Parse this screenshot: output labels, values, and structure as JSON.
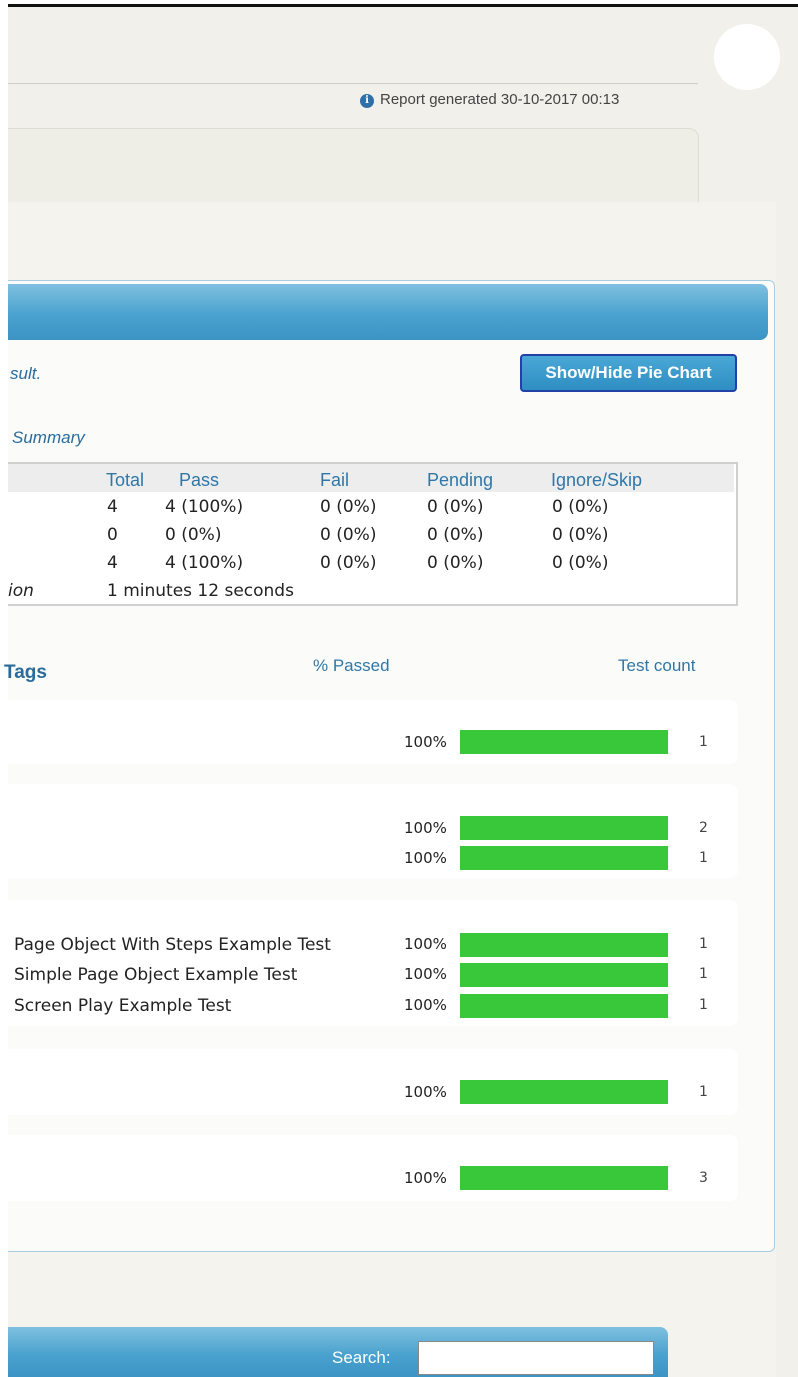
{
  "header": {
    "report_generated": "Report generated 30-10-2017 00:13"
  },
  "panel": {
    "result_text": "sult.",
    "pie_button": "Show/Hide Pie Chart",
    "summary_title": "Summary"
  },
  "summary_table": {
    "columns": [
      "Total",
      "Pass",
      "Fail",
      "Pending",
      "Ignore/Skip"
    ],
    "rows": [
      {
        "label": "",
        "cells": [
          "4",
          "4 (100%)",
          "0 (0%)",
          "0 (0%)",
          "0 (0%)"
        ]
      },
      {
        "label": "",
        "cells": [
          "0",
          "0 (0%)",
          "0 (0%)",
          "0 (0%)",
          "0 (0%)"
        ]
      },
      {
        "label": "",
        "cells": [
          "4",
          "4 (100%)",
          "0 (0%)",
          "0 (0%)",
          "0 (0%)"
        ]
      }
    ],
    "duration_label": "ion",
    "duration_value": "1 minutes 12 seconds"
  },
  "tags": {
    "title": "Tags",
    "passed_header": "% Passed",
    "count_header": "Test count",
    "groups": [
      {
        "rows": [
          {
            "label": "",
            "pct": "100%",
            "fraction": 1.0,
            "count": "1"
          }
        ]
      },
      {
        "rows": [
          {
            "label": "",
            "pct": "100%",
            "fraction": 1.0,
            "count": "2"
          },
          {
            "label": "",
            "pct": "100%",
            "fraction": 1.0,
            "count": "1"
          }
        ]
      },
      {
        "rows": [
          {
            "label": "Page Object With Steps Example Test",
            "pct": "100%",
            "fraction": 1.0,
            "count": "1"
          },
          {
            "label": "Simple Page Object Example Test",
            "pct": "100%",
            "fraction": 1.0,
            "count": "1"
          },
          {
            "label": "Screen Play Example Test",
            "pct": "100%",
            "fraction": 1.0,
            "count": "1"
          }
        ]
      },
      {
        "rows": [
          {
            "label": "",
            "pct": "100%",
            "fraction": 1.0,
            "count": "1"
          }
        ]
      },
      {
        "rows": [
          {
            "label": "",
            "pct": "100%",
            "fraction": 1.0,
            "count": "3"
          }
        ]
      }
    ]
  },
  "bottom": {
    "search_label": "Search:",
    "search_value": ""
  },
  "colors": {
    "bar_fill": "#39c839",
    "header_blue": "#4aa2cf",
    "link_blue": "#2f77a8"
  }
}
